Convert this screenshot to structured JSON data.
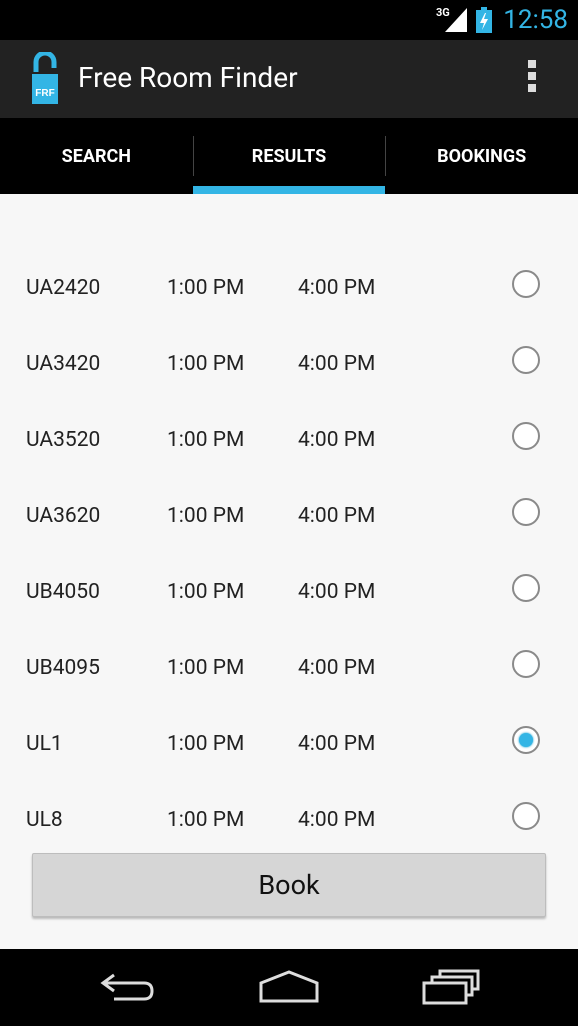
{
  "status_bar": {
    "network": "3G",
    "time": "12:58",
    "accent_color": "#33b5e5"
  },
  "action_bar": {
    "logo_text": "FRF",
    "title": "Free Room Finder",
    "overflow_icon": "overflow-menu-icon"
  },
  "tabs": [
    {
      "label": "SEARCH",
      "selected": false
    },
    {
      "label": "RESULTS",
      "selected": true
    },
    {
      "label": "BOOKINGS",
      "selected": false
    }
  ],
  "results": [
    {
      "room": "UA2420",
      "start": "1:00 PM",
      "end": "4:00 PM",
      "checked": false
    },
    {
      "room": "UA3420",
      "start": "1:00 PM",
      "end": "4:00 PM",
      "checked": false
    },
    {
      "room": "UA3520",
      "start": "1:00 PM",
      "end": "4:00 PM",
      "checked": false
    },
    {
      "room": "UA3620",
      "start": "1:00 PM",
      "end": "4:00 PM",
      "checked": false
    },
    {
      "room": "UB4050",
      "start": "1:00 PM",
      "end": "4:00 PM",
      "checked": false
    },
    {
      "room": "UB4095",
      "start": "1:00 PM",
      "end": "4:00 PM",
      "checked": false
    },
    {
      "room": "UL1",
      "start": "1:00 PM",
      "end": "4:00 PM",
      "checked": true
    },
    {
      "room": "UL8",
      "start": "1:00 PM",
      "end": "4:00 PM",
      "checked": false
    }
  ],
  "book_button": {
    "label": "Book"
  },
  "nav_bar": {
    "icons": [
      "back-icon",
      "home-icon",
      "recent-apps-icon"
    ]
  }
}
